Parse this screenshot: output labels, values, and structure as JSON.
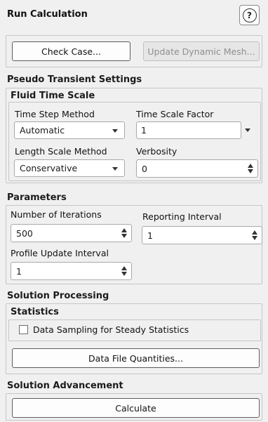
{
  "panel": {
    "title": "Run Calculation",
    "help_icon": "question-circle-icon",
    "help_glyph": "?"
  },
  "top_buttons": {
    "check_case": "Check Case...",
    "update_mesh": "Update Dynamic Mesh..."
  },
  "pseudo_transient": {
    "heading": "Pseudo Transient Settings",
    "fluid_heading": "Fluid Time Scale",
    "time_step_method": {
      "label": "Time Step Method",
      "value": "Automatic"
    },
    "time_scale_factor": {
      "label": "Time Scale Factor",
      "value": "1"
    },
    "length_scale_method": {
      "label": "Length Scale Method",
      "value": "Conservative"
    },
    "verbosity": {
      "label": "Verbosity",
      "value": "0"
    }
  },
  "parameters": {
    "heading": "Parameters",
    "iterations": {
      "label": "Number of Iterations",
      "value": "500"
    },
    "reporting": {
      "label": "Reporting Interval",
      "value": "1"
    },
    "profile_update": {
      "label": "Profile Update Interval",
      "value": "1"
    }
  },
  "solution_processing": {
    "heading": "Solution Processing",
    "statistics_heading": "Statistics",
    "data_sampling_label": "Data Sampling for Steady Statistics",
    "data_sampling_checked": false,
    "data_file_button": "Data File Quantities..."
  },
  "solution_advancement": {
    "heading": "Solution Advancement",
    "calculate_button": "Calculate"
  }
}
